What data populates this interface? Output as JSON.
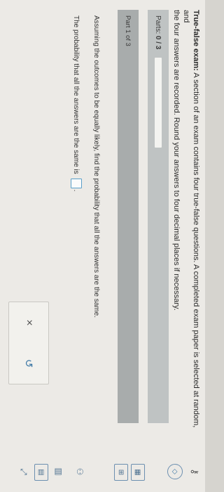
{
  "problem": {
    "title": "True-false exam:",
    "text_line1": " A section of an exam contains four true-false questions. A completed exam paper is selected at random, and",
    "text_line2": "the four answers are recorded. Round your answers to four decimal places if necessary."
  },
  "progress": {
    "label_prefix": "Parts:",
    "value": "0 / 3",
    "fraction": 0
  },
  "part": {
    "label": "Part 1 of 3"
  },
  "question": {
    "text": "Assuming the outcomes to be equally likely, find the probability that all the answers are the same.",
    "answer_prefix": "The probability that all the answers are the same is",
    "answer_value": "",
    "answer_suffix": "."
  },
  "actions": {
    "clear_symbol": "×",
    "undo_symbol": "↺"
  },
  "toolbar": {
    "icons": [
      "key-icon",
      "nav-icon",
      "calc-icon",
      "grid-icon",
      "people-icon",
      "barchart-icon",
      "table-icon",
      "expand-icon"
    ]
  },
  "colors": {
    "accent": "#3f79a6",
    "page_bg": "#eceae6",
    "progress_row_bg": "#bfc3c3",
    "part_header_bg": "#a8acac"
  }
}
